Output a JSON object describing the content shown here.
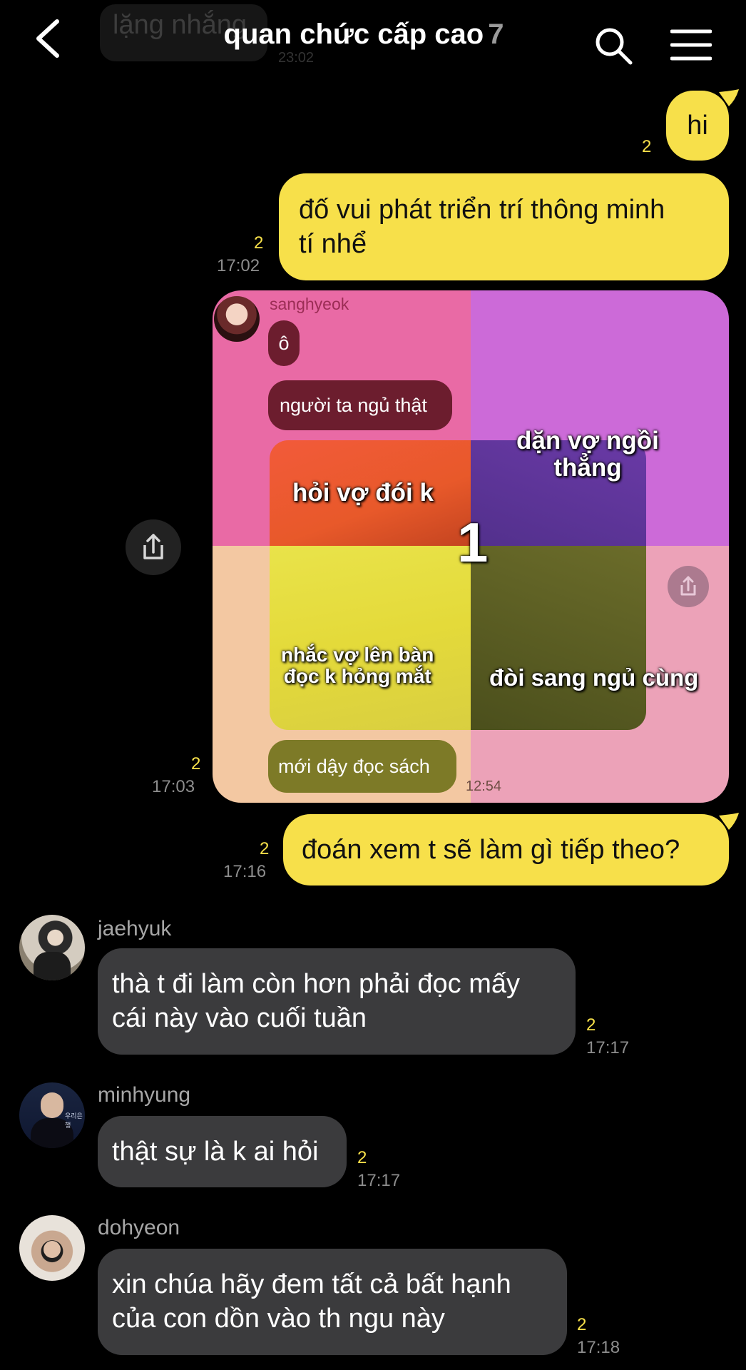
{
  "header": {
    "title": "quan chức cấp cao",
    "member_count": "7",
    "ghost_message": "lặng nhắng",
    "ghost_time": "23:02"
  },
  "messages": {
    "hi": {
      "text": "hi",
      "unread": "2"
    },
    "riddle": {
      "text_line1": "đố vui phát triển trí thông minh",
      "text_line2": "tí nhể",
      "unread": "2",
      "time": "17:02"
    },
    "image": {
      "unread": "2",
      "time": "17:03",
      "inner_sender": "sanghyeok",
      "inner_bubble1": "ô",
      "inner_bubble2": "người ta ngủ thật",
      "inner_bubble3": "mới dậy đọc sách",
      "inner_time": "12:54",
      "caption_top_left": "hỏi vợ đói k",
      "caption_top_right_l1": "dặn vợ ngồi",
      "caption_top_right_l2": "thẳng",
      "caption_center": "1",
      "caption_bottom_left_l1": "nhắc vợ lên bàn",
      "caption_bottom_left_l2": "đọc k hỏng mắt",
      "caption_bottom_right": "đòi sang ngủ cùng"
    },
    "guess": {
      "text": "đoán xem t sẽ làm gì tiếp theo?",
      "unread": "2",
      "time": "17:16"
    },
    "jaehyuk": {
      "sender": "jaehyuk",
      "text_line1": "thà t đi làm còn hơn phải đọc mấy",
      "text_line2": "cái này vào cuối tuần",
      "unread": "2",
      "time": "17:17"
    },
    "minhyung": {
      "sender": "minhyung",
      "text": "thật sự là k ai hỏi",
      "unread": "2",
      "time": "17:17",
      "avatar_badge": "우리은행"
    },
    "dohyeon": {
      "sender": "dohyeon",
      "text_line1": "xin chúa hãy đem tất cả bất hạnh",
      "text_line2": "của con dồn vào th ngu này",
      "unread": "2",
      "time": "17:18"
    }
  },
  "colors": {
    "background": "#000000",
    "my_bubble": "#f7e04a",
    "their_bubble": "#3b3b3d",
    "unread": "#f7e04a",
    "quadrant_pink": "#e96aa5",
    "quadrant_purple": "#cc6ad8",
    "quadrant_yellow": "#f2e048",
    "quadrant_peach": "#f3c8a2"
  },
  "icons": [
    "back-icon",
    "search-icon",
    "menu-icon",
    "share-icon"
  ]
}
